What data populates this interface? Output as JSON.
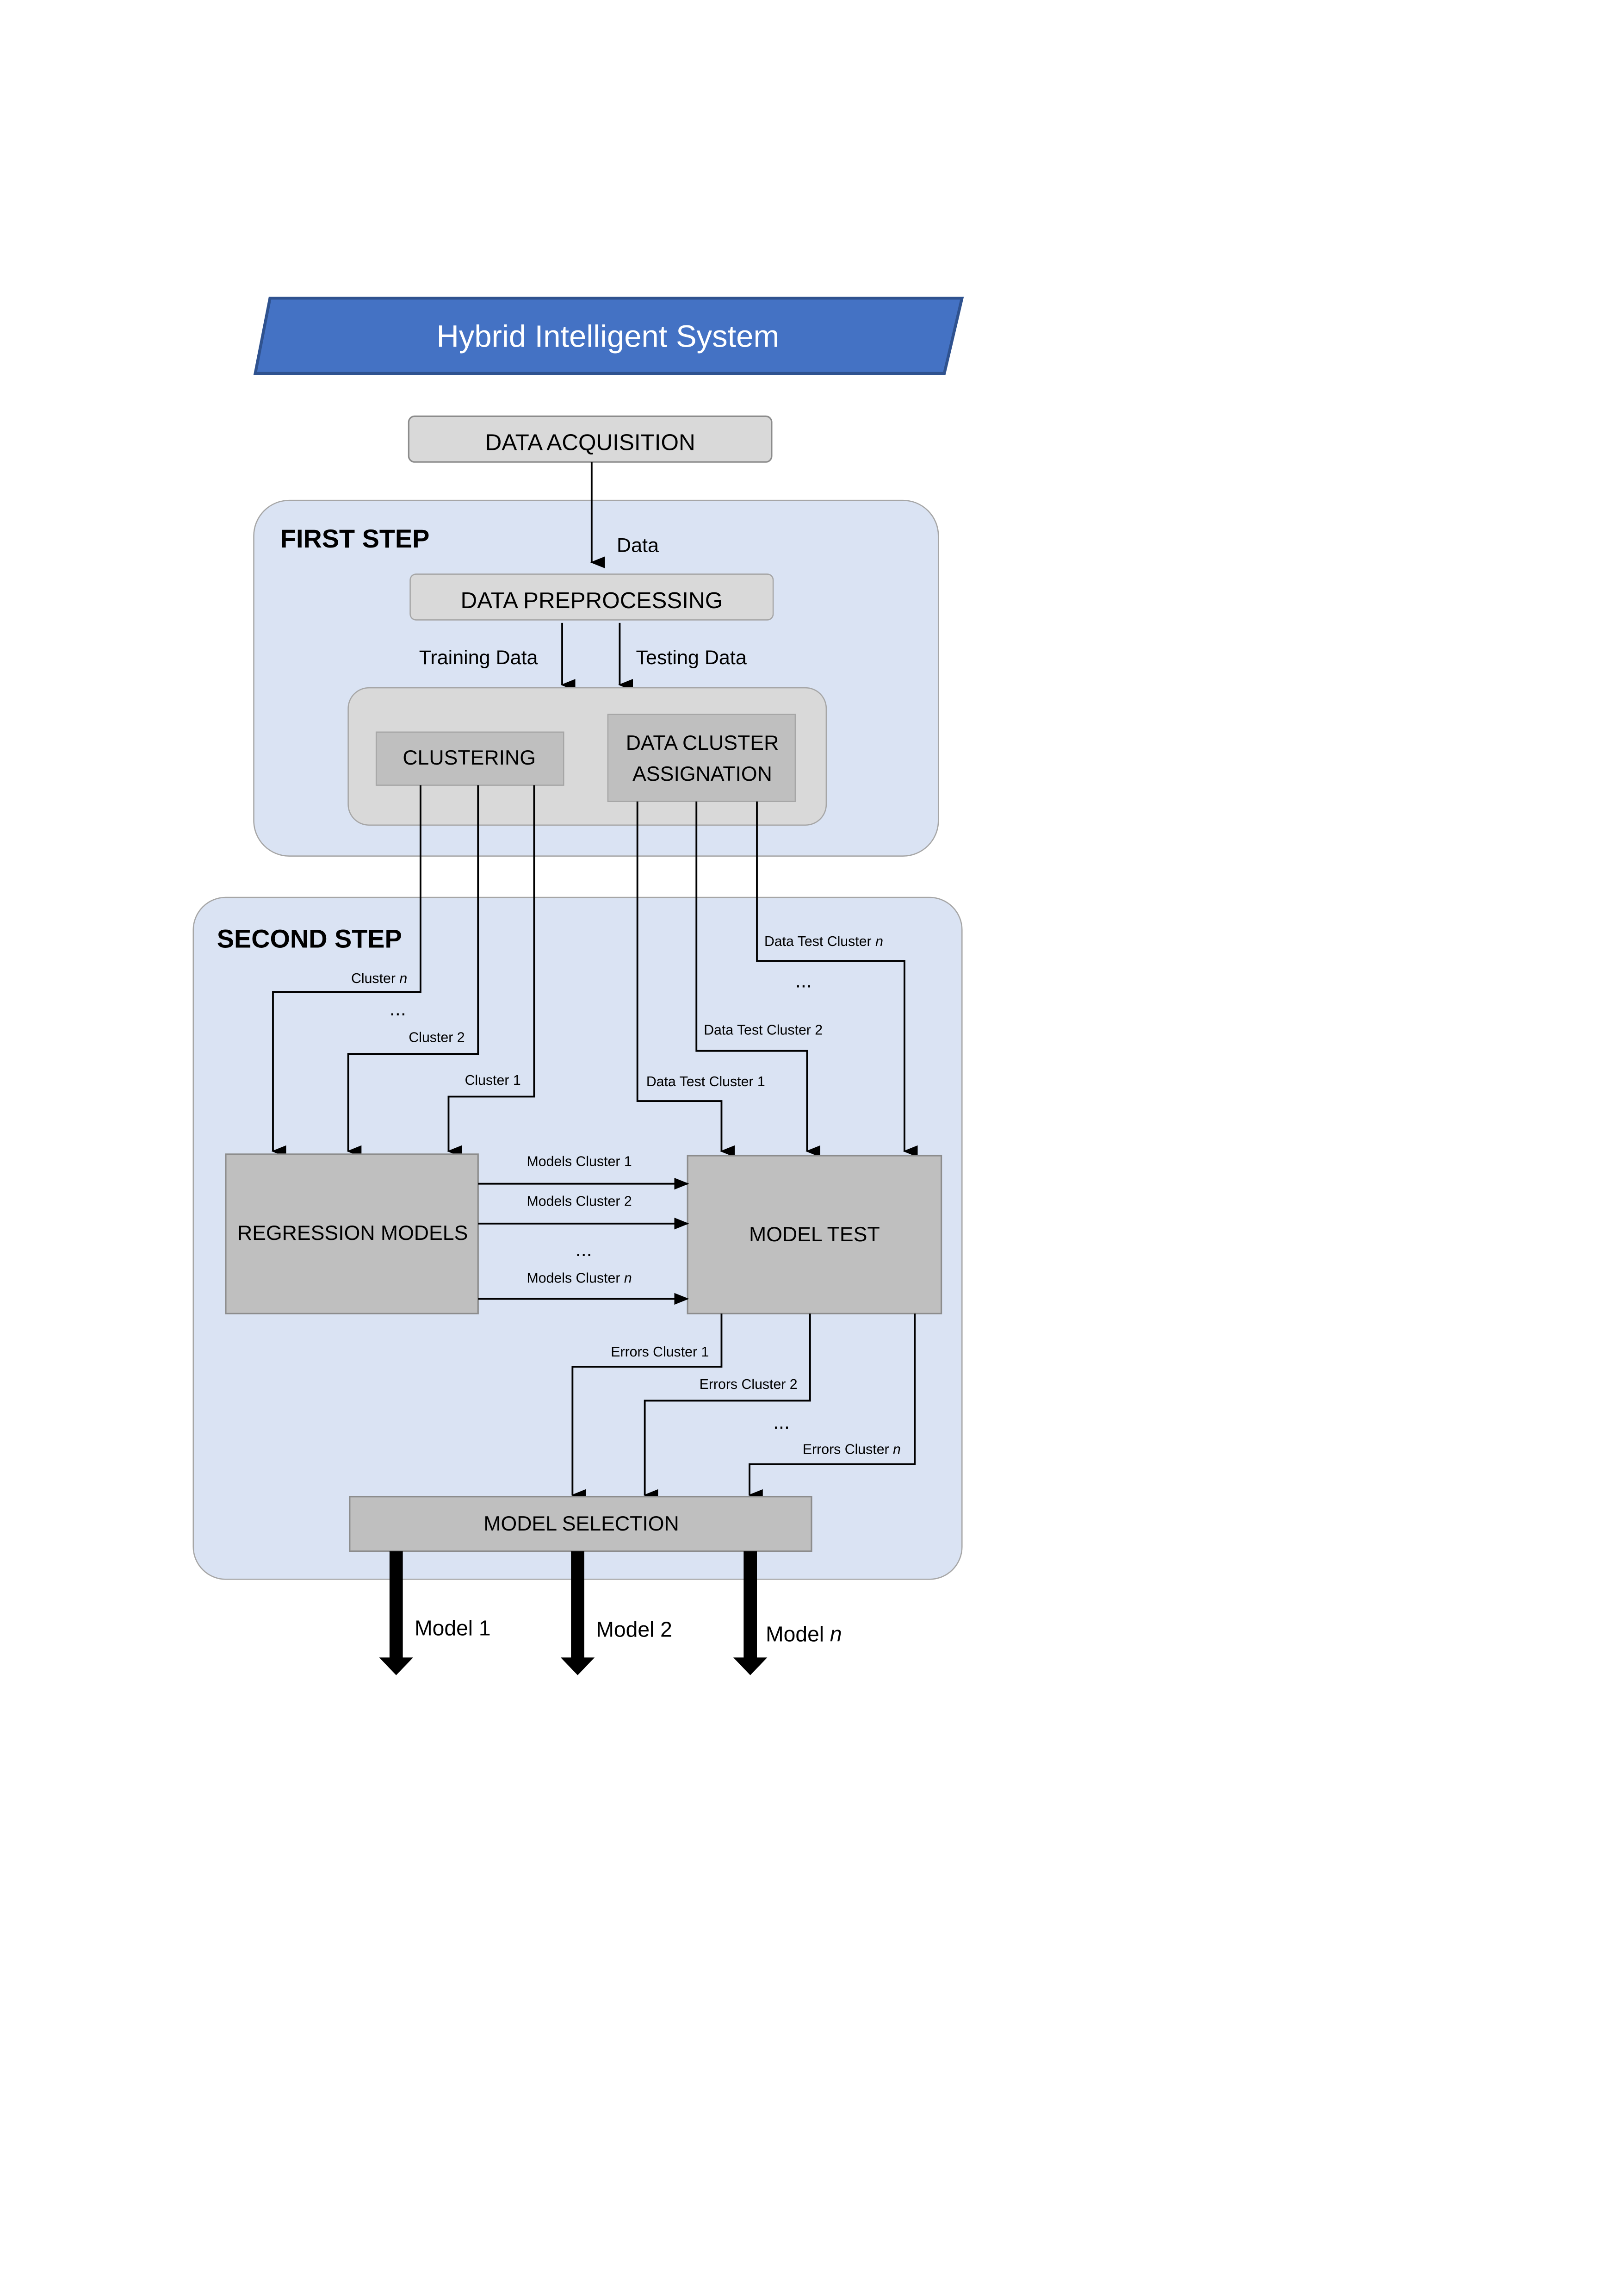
{
  "title": "Hybrid Intelligent System",
  "nodes": {
    "data_acquisition": "DATA ACQUISITION",
    "data_preprocessing": "DATA PREPROCESSING",
    "clustering": "CLUSTERING",
    "data_cluster_assignation_line1": "DATA CLUSTER",
    "data_cluster_assignation_line2": "ASSIGNATION",
    "regression_models": "REGRESSION MODELS",
    "model_test": "MODEL TEST",
    "model_selection": "MODEL SELECTION"
  },
  "steps": {
    "first": "FIRST STEP",
    "second": "SECOND STEP"
  },
  "edges": {
    "data": "Data",
    "training_data": "Training Data",
    "testing_data": "Testing Data",
    "cluster_n": "Cluster",
    "cluster_n_var": "n",
    "cluster_ellipsis": "...",
    "cluster_2": "Cluster 2",
    "cluster_1": "Cluster 1",
    "data_test_cluster_n": "Data Test Cluster",
    "data_test_cluster_n_var": "n",
    "data_test_ellipsis": "...",
    "data_test_cluster_2": "Data Test Cluster 2",
    "data_test_cluster_1": "Data Test Cluster 1",
    "models_cluster_1": "Models Cluster 1",
    "models_cluster_2": "Models Cluster 2",
    "models_ellipsis": "...",
    "models_cluster_n": "Models Cluster",
    "models_cluster_n_var": "n",
    "errors_cluster_1": "Errors Cluster 1",
    "errors_cluster_2": "Errors Cluster 2",
    "errors_ellipsis": "...",
    "errors_cluster_n": "Errors Cluster",
    "errors_cluster_n_var": "n"
  },
  "outputs": [
    {
      "label": "Model 1",
      "var": ""
    },
    {
      "label": "Model 2",
      "var": ""
    },
    {
      "label": "Model",
      "var": "n"
    }
  ],
  "colors": {
    "title_fill": "#4472C4",
    "title_border": "#2F528F",
    "step_fill": "#DAE3F3",
    "node_light": "#D9D9D9",
    "node_dark": "#BFBFBF",
    "border": "#8C8C8C"
  }
}
